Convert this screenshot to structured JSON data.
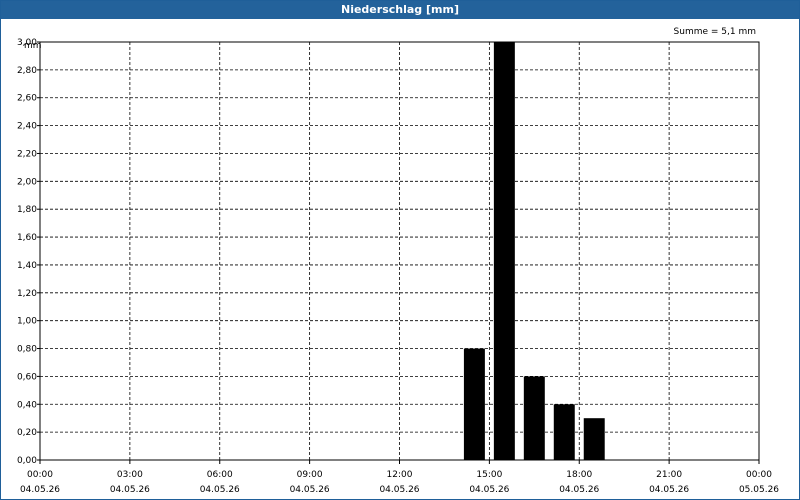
{
  "window": {
    "title": "Niederschlag [mm]"
  },
  "chart_data": {
    "type": "bar",
    "title": "Niederschlag [mm]",
    "ylabel": "mm",
    "annotation": "Summe = 5,1 mm",
    "ylim": [
      0,
      3.0
    ],
    "y_ticks": [
      "0,00",
      "0,20",
      "0,40",
      "0,60",
      "0,80",
      "1,00",
      "1,20",
      "1,40",
      "1,60",
      "1,80",
      "2,00",
      "2,20",
      "2,40",
      "2,60",
      "2,80",
      "3,00"
    ],
    "x_range_hours": [
      0,
      24
    ],
    "x_ticks": [
      {
        "time": "00:00",
        "date": "04.05.26"
      },
      {
        "time": "03:00",
        "date": "04.05.26"
      },
      {
        "time": "06:00",
        "date": "04.05.26"
      },
      {
        "time": "09:00",
        "date": "04.05.26"
      },
      {
        "time": "12:00",
        "date": "04.05.26"
      },
      {
        "time": "15:00",
        "date": "04.05.26"
      },
      {
        "time": "18:00",
        "date": "04.05.26"
      },
      {
        "time": "21:00",
        "date": "04.05.26"
      },
      {
        "time": "00:00",
        "date": "05.05.26"
      }
    ],
    "bars": [
      {
        "time": "14:00",
        "value": 0.8
      },
      {
        "time": "15:00",
        "value": 3.0
      },
      {
        "time": "16:00",
        "value": 0.6
      },
      {
        "time": "17:00",
        "value": 0.4
      },
      {
        "time": "18:00",
        "value": 0.3
      }
    ],
    "grid": true,
    "bar_color": "#000000"
  }
}
